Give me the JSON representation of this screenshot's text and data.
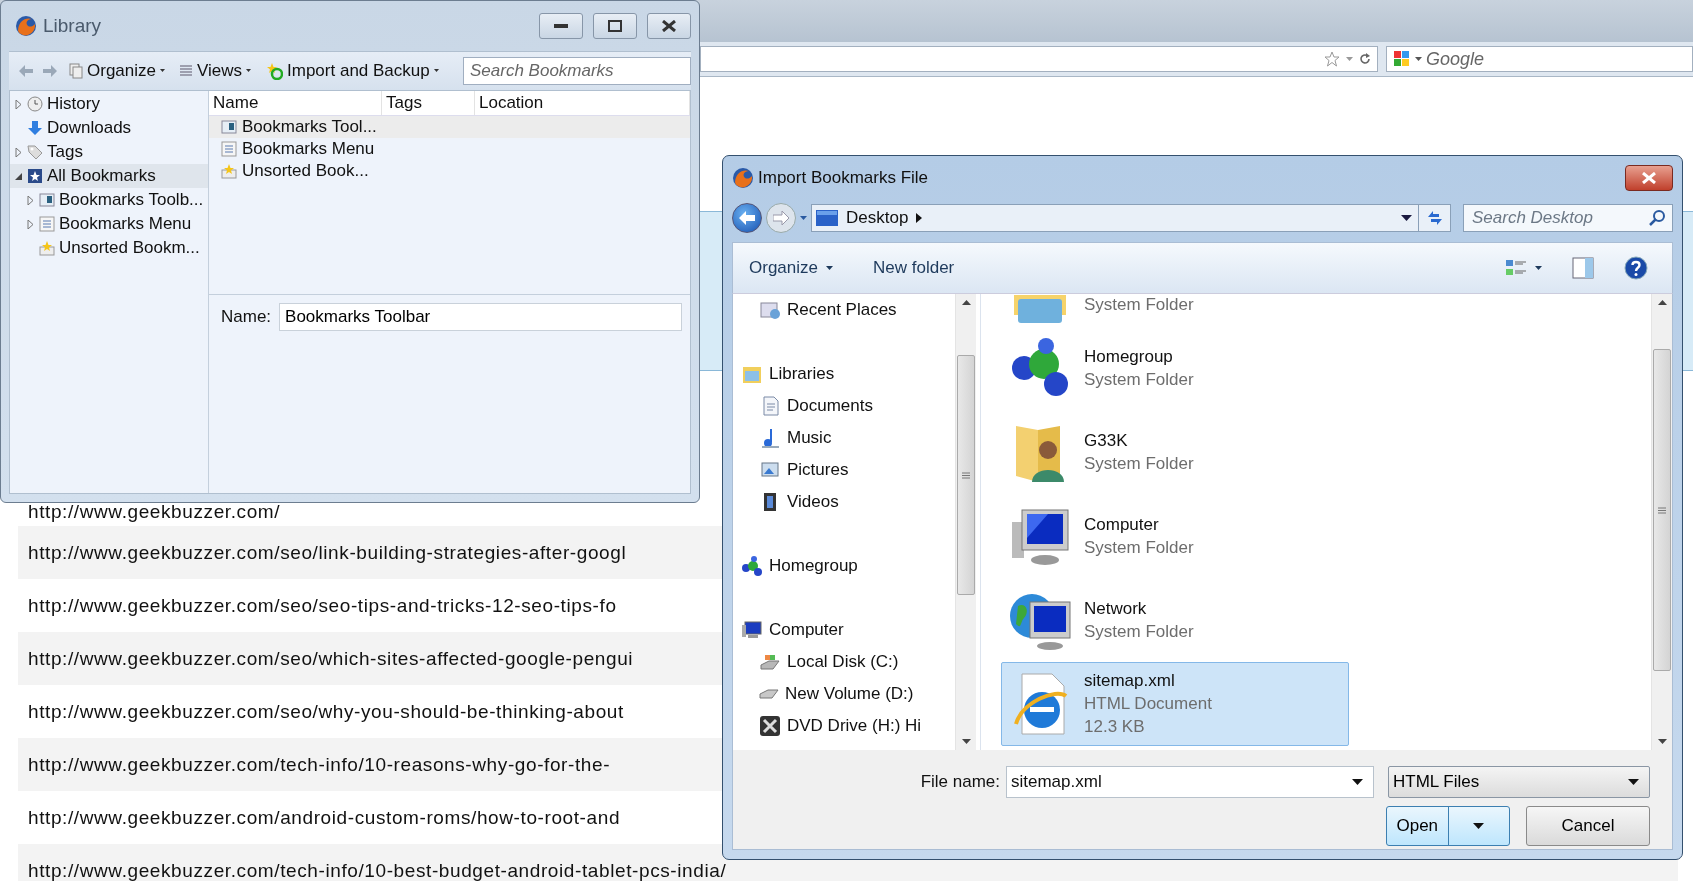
{
  "browser": {
    "search": {
      "placeholder": "Google"
    },
    "links": [
      {
        "text": "http://www.geekbuzzer.com/",
        "shaded": false
      },
      {
        "text": "http://www.geekbuzzer.com/seo/link-building-strategies-after-googl",
        "shaded": true
      },
      {
        "text": "http://www.geekbuzzer.com/seo/seo-tips-and-tricks-12-seo-tips-fo",
        "shaded": false
      },
      {
        "text": "http://www.geekbuzzer.com/seo/which-sites-affected-google-pengui",
        "shaded": true
      },
      {
        "text": "http://www.geekbuzzer.com/seo/why-you-should-be-thinking-about",
        "shaded": false
      },
      {
        "text": "http://www.geekbuzzer.com/tech-info/10-reasons-why-go-for-the-",
        "shaded": true
      },
      {
        "text": "http://www.geekbuzzer.com/android-custom-roms/how-to-root-and",
        "shaded": false
      },
      {
        "text": "http://www.geekbuzzer.com/tech-info/10-best-budget-android-tablet-pcs-india/",
        "shaded": true
      }
    ]
  },
  "library": {
    "title": "Library",
    "toolbar": [
      {
        "label": "Organize",
        "kind": "organize"
      },
      {
        "label": "Views",
        "kind": "views"
      },
      {
        "label": "Import and Backup",
        "kind": "import"
      }
    ],
    "search": {
      "placeholder": "Search Bookmarks"
    },
    "tree": [
      {
        "label": "History",
        "kind": "history",
        "expanded": false,
        "selected": false
      },
      {
        "label": "Downloads",
        "kind": "downloads",
        "selected": false
      },
      {
        "label": "Tags",
        "kind": "tags",
        "expanded": false,
        "selected": false
      },
      {
        "label": "All Bookmarks",
        "kind": "all",
        "expanded": true,
        "selected": true,
        "children": [
          {
            "label": "Bookmarks Toolb...",
            "kind": "toolbar",
            "expanded": false,
            "selected": false
          },
          {
            "label": "Bookmarks Menu",
            "kind": "menu",
            "expanded": false,
            "selected": false
          },
          {
            "label": "Unsorted Bookm...",
            "kind": "unsorted",
            "selected": false
          }
        ]
      }
    ],
    "columns": [
      "Name",
      "Tags",
      "Location"
    ],
    "rows": [
      {
        "name": "Bookmarks Tool...",
        "kind": "toolbar",
        "selected": true
      },
      {
        "name": "Bookmarks Menu",
        "kind": "menu",
        "selected": false
      },
      {
        "name": "Unsorted Book...",
        "kind": "unsorted",
        "selected": false
      }
    ],
    "name_label": "Name:",
    "name_value": "Bookmarks Toolbar"
  },
  "dialog": {
    "title": "Import Bookmarks File",
    "location": "Desktop",
    "search": {
      "placeholder": "Search Desktop"
    },
    "commands": [
      {
        "label": "Organize",
        "kind": "menu"
      },
      {
        "label": "New folder",
        "kind": "plain"
      }
    ],
    "nav": [
      {
        "children": [
          {
            "label": "Recent Places",
            "kind": "recent"
          }
        ]
      },
      {
        "label": "Libraries",
        "kind": "libraries",
        "children": [
          {
            "label": "Documents",
            "kind": "documents"
          },
          {
            "label": "Music",
            "kind": "music"
          },
          {
            "label": "Pictures",
            "kind": "pictures"
          },
          {
            "label": "Videos",
            "kind": "videos"
          }
        ]
      },
      {
        "label": "Homegroup",
        "kind": "homegroup"
      },
      {
        "label": "Computer",
        "kind": "computer",
        "children": [
          {
            "label": "Local Disk (C:)",
            "kind": "disk"
          },
          {
            "label": "New Volume (D:)",
            "kind": "drive"
          },
          {
            "label": "DVD Drive (H:) Hi",
            "kind": "dvd"
          }
        ]
      }
    ],
    "files": [
      {
        "kind": "library",
        "details": [
          "System Folder"
        ],
        "selected": false
      },
      {
        "kind": "homegroup",
        "name": "Homegroup",
        "details": [
          "System Folder"
        ],
        "selected": false
      },
      {
        "kind": "user",
        "name": "G33K",
        "details": [
          "System Folder"
        ],
        "selected": false
      },
      {
        "kind": "computer",
        "name": "Computer",
        "details": [
          "System Folder"
        ],
        "selected": false
      },
      {
        "kind": "network",
        "name": "Network",
        "details": [
          "System Folder"
        ],
        "selected": false
      },
      {
        "kind": "html",
        "name": "sitemap.xml",
        "details": [
          "HTML Document",
          "12.3 KB"
        ],
        "selected": true
      }
    ],
    "file_name_label": "File name:",
    "file_name": "sitemap.xml",
    "filter": "HTML Files",
    "buttons": [
      {
        "label": "Open",
        "kind": "split"
      },
      {
        "label": "Cancel",
        "kind": "plain"
      }
    ]
  }
}
